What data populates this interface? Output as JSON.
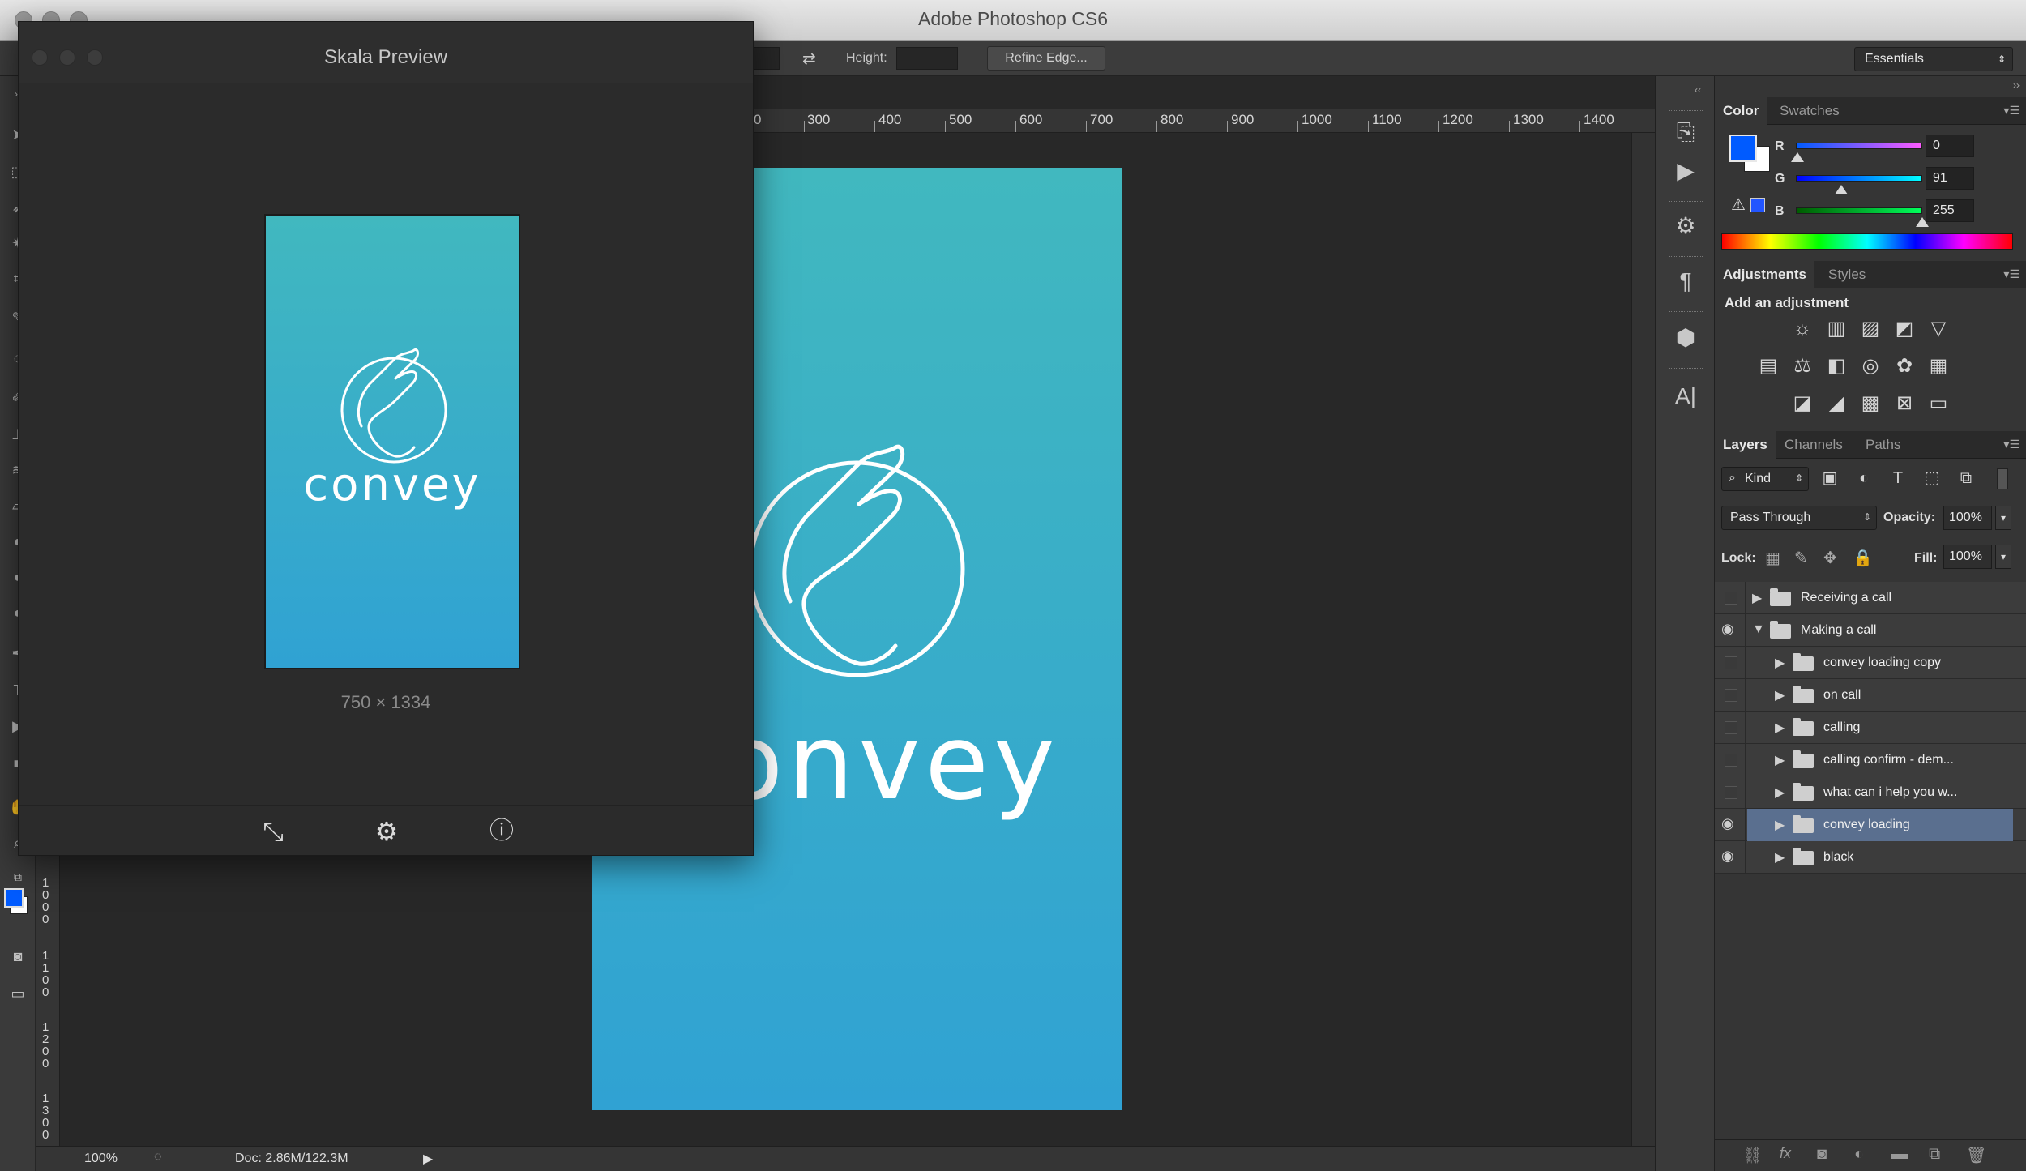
{
  "app": {
    "title": "Adobe Photoshop CS6"
  },
  "options_bar": {
    "height_label": "Height:",
    "refine_edge_label": "Refine Edge...",
    "workspace": "Essentials"
  },
  "ruler": {
    "h_labels": [
      "0",
      "300",
      "400",
      "500",
      "600",
      "700",
      "800",
      "900",
      "1000",
      "1100",
      "1200",
      "1300",
      "1400"
    ],
    "v_labels": [
      "1000",
      "1100",
      "1200",
      "1300"
    ]
  },
  "document": {
    "wordmark": "onvey"
  },
  "status_bar": {
    "zoom": "100%",
    "doc_info": "Doc: 2.86M/122.3M"
  },
  "skala": {
    "title": "Skala Preview",
    "preview_wordmark": "convey",
    "dimensions": "750 × 1334",
    "footer_icons": [
      "swap-icon",
      "gear-icon",
      "help-icon"
    ]
  },
  "color_panel": {
    "tabs": [
      "Color",
      "Swatches"
    ],
    "channels": [
      {
        "label": "R",
        "value": "0"
      },
      {
        "label": "G",
        "value": "91"
      },
      {
        "label": "B",
        "value": "255"
      }
    ],
    "foreground": "#005bff"
  },
  "adjustments_panel": {
    "tabs": [
      "Adjustments",
      "Styles"
    ],
    "heading": "Add an adjustment"
  },
  "layers_panel": {
    "tabs": [
      "Layers",
      "Channels",
      "Paths"
    ],
    "filter_kind": "Kind",
    "blend_mode": "Pass Through",
    "opacity_label": "Opacity:",
    "opacity": "100%",
    "lock_label": "Lock:",
    "fill_label": "Fill:",
    "fill": "100%",
    "layers": [
      {
        "name": "Receiving a call",
        "visible": false,
        "expanded": false,
        "level": 0,
        "selected": false
      },
      {
        "name": "Making a call",
        "visible": true,
        "expanded": true,
        "level": 0,
        "selected": false
      },
      {
        "name": "convey loading copy",
        "visible": false,
        "expanded": false,
        "level": 1,
        "selected": false
      },
      {
        "name": "on call",
        "visible": false,
        "expanded": false,
        "level": 1,
        "selected": false
      },
      {
        "name": "calling",
        "visible": false,
        "expanded": false,
        "level": 1,
        "selected": false
      },
      {
        "name": "calling confirm - dem...",
        "visible": false,
        "expanded": false,
        "level": 1,
        "selected": false
      },
      {
        "name": "what can i help you w...",
        "visible": false,
        "expanded": false,
        "level": 1,
        "selected": false
      },
      {
        "name": "convey loading",
        "visible": true,
        "expanded": false,
        "level": 1,
        "selected": true
      },
      {
        "name": "black",
        "visible": true,
        "expanded": false,
        "level": 1,
        "selected": false
      }
    ]
  }
}
